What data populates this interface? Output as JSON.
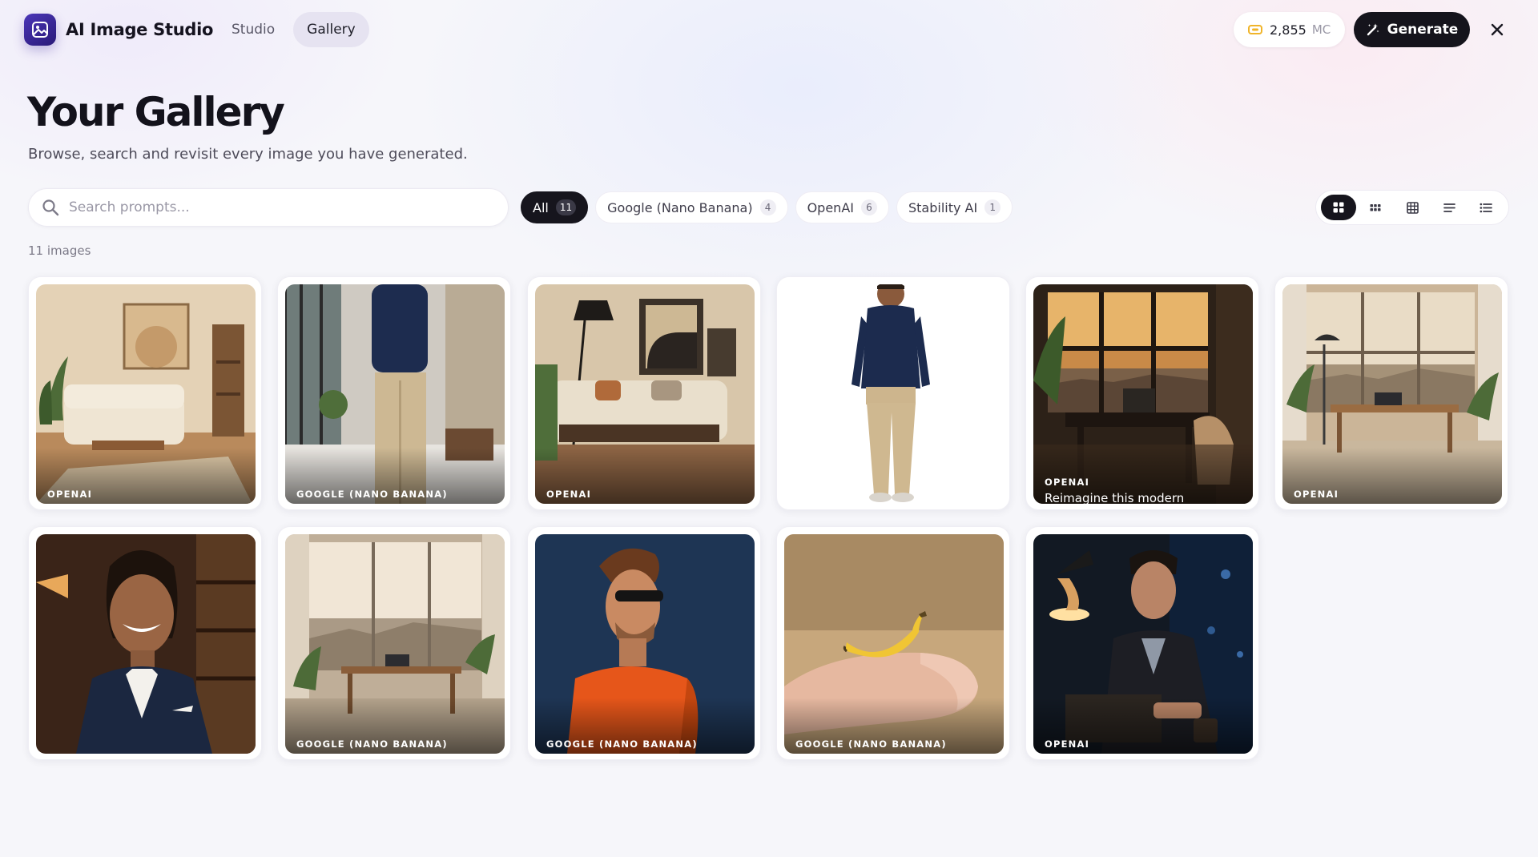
{
  "header": {
    "app_name": "AI Image Studio",
    "nav": [
      {
        "label": "Studio",
        "active": false
      },
      {
        "label": "Gallery",
        "active": true
      }
    ],
    "credits": {
      "value": "2,855",
      "unit": "MC"
    },
    "generate_label": "Generate"
  },
  "page": {
    "title": "Your Gallery",
    "subtitle": "Browse, search and revisit every image you have generated."
  },
  "search": {
    "placeholder": "Search prompts..."
  },
  "filters": [
    {
      "label": "All",
      "count": "11",
      "active": true
    },
    {
      "label": "Google (Nano Banana)",
      "count": "4",
      "active": false
    },
    {
      "label": "OpenAI",
      "count": "6",
      "active": false
    },
    {
      "label": "Stability AI",
      "count": "1",
      "active": false
    }
  ],
  "view_modes": [
    {
      "icon": "grid-large-icon",
      "active": true
    },
    {
      "icon": "grid-small-icon",
      "active": false
    },
    {
      "icon": "table-grid-icon",
      "active": false
    },
    {
      "icon": "list-compact-icon",
      "active": false
    },
    {
      "icon": "list-detailed-icon",
      "active": false
    }
  ],
  "image_count": "11 images",
  "images": [
    {
      "provider": "OPENAI",
      "subject": "beige living room with sofa and art",
      "prompt": ""
    },
    {
      "provider": "GOOGLE (NANO BANANA)",
      "subject": "man in navy shirt in modern interior",
      "prompt": ""
    },
    {
      "provider": "OPENAI",
      "subject": "living room with leather cushions and lamp",
      "prompt": ""
    },
    {
      "provider": "",
      "subject": "man in navy shirt on white background",
      "prompt": ""
    },
    {
      "provider": "OPENAI",
      "subject": "desk by window at sunset",
      "prompt": "Reimagine this modern"
    },
    {
      "provider": "OPENAI",
      "subject": "office with city view",
      "prompt": ""
    },
    {
      "provider": "",
      "subject": "smiling woman in navy blazer",
      "prompt": ""
    },
    {
      "provider": "GOOGLE (NANO BANANA)",
      "subject": "desk by window with city skyline",
      "prompt": ""
    },
    {
      "provider": "GOOGLE (NANO BANANA)",
      "subject": "man in sunglasses and orange shirt",
      "prompt": ""
    },
    {
      "provider": "GOOGLE (NANO BANANA)",
      "subject": "tiny banana on fingertip",
      "prompt": ""
    },
    {
      "provider": "OPENAI",
      "subject": "man working on laptop at night",
      "prompt": ""
    }
  ],
  "colors": {
    "accent": "#16151d",
    "brand": "#3b2a9a",
    "credit_coin": "#f0b429"
  }
}
